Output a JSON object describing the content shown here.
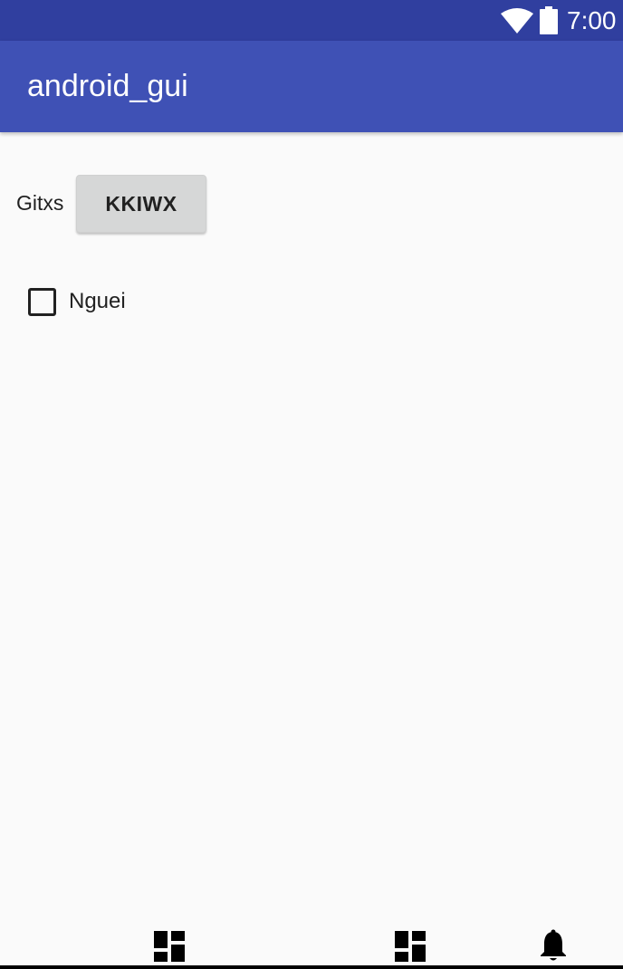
{
  "status_bar": {
    "time": "7:00",
    "icons": [
      "wifi-icon",
      "battery-icon"
    ]
  },
  "app_bar": {
    "title": "android_gui"
  },
  "main": {
    "label": "Gitxs",
    "button_label": "KKIWX",
    "checkbox": {
      "label": "Nguei",
      "checked": false
    }
  },
  "nav_bar": {
    "icons": [
      "dashboard-icon",
      "dashboard-icon",
      "notification-bell-icon"
    ]
  },
  "colors": {
    "status_bar": "#303f9f",
    "app_bar": "#3f51b5",
    "background": "#fafafa",
    "button": "#d6d7d7",
    "text": "#212121"
  }
}
